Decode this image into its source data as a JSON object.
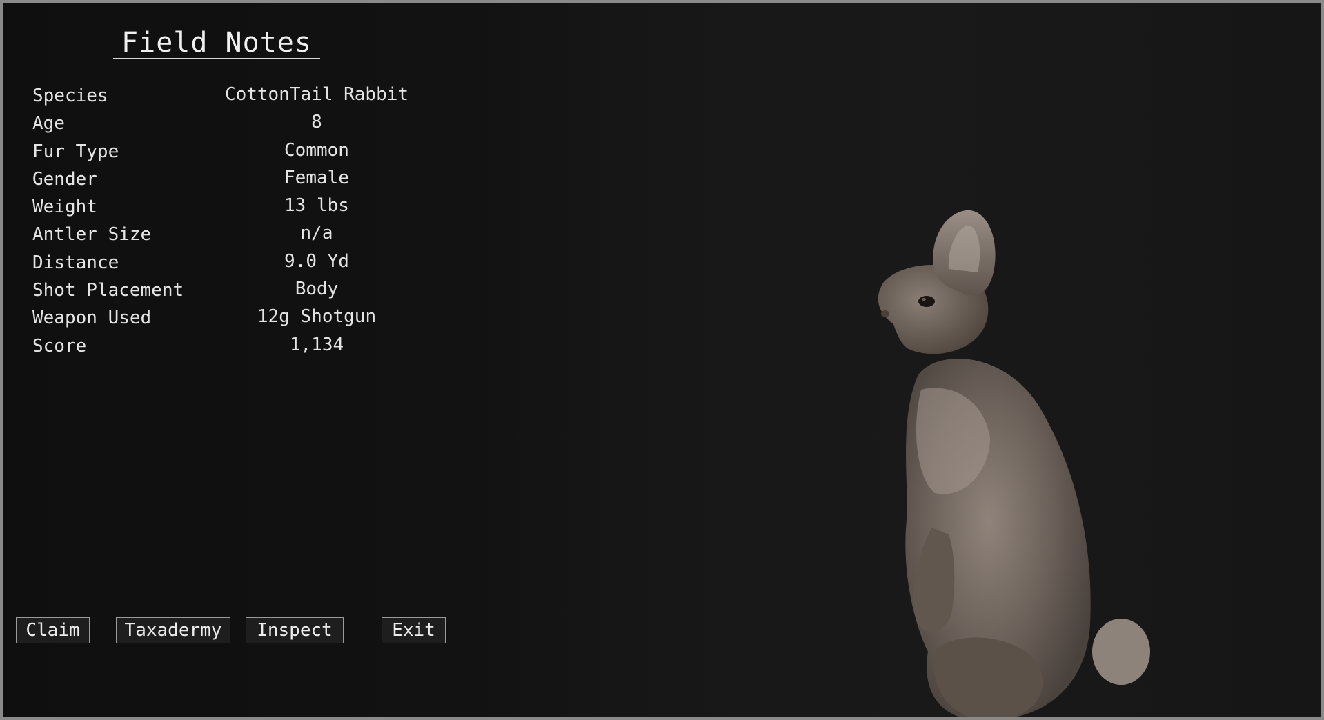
{
  "panel": {
    "title": "Field Notes",
    "rows": [
      {
        "label": "Species",
        "value": "CottonTail Rabbit"
      },
      {
        "label": "Age",
        "value": "8"
      },
      {
        "label": "Fur Type",
        "value": "Common"
      },
      {
        "label": "Gender",
        "value": "Female"
      },
      {
        "label": "Weight",
        "value": "13 lbs"
      },
      {
        "label": "Antler Size",
        "value": "n/a"
      },
      {
        "label": "Distance",
        "value": "9.0 Yd"
      },
      {
        "label": "Shot Placement",
        "value": "Body"
      },
      {
        "label": "Weapon Used",
        "value": "12g Shotgun"
      },
      {
        "label": "Score",
        "value": "1,134"
      }
    ]
  },
  "buttons": {
    "claim": "Claim",
    "taxadermy": "Taxadermy",
    "inspect": "Inspect",
    "exit": "Exit"
  },
  "scene": {
    "subject_icon": "rabbit-model",
    "colors": {
      "background": "#151515",
      "fur": "#6e625a",
      "fur_light": "#a89a90"
    }
  }
}
